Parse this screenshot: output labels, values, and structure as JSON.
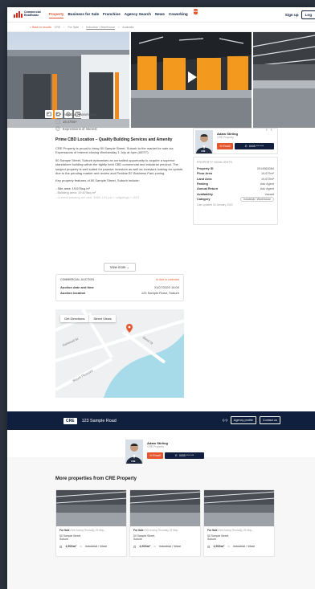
{
  "header": {
    "logo_line1": "Commercial",
    "logo_line2": "RealEstate",
    "nav": [
      "Property",
      "Business for Sale",
      "Franchise",
      "Agency Search",
      "News",
      "Coworking"
    ],
    "new_badge": "New",
    "signup": "Sign up",
    "login": "Log"
  },
  "breadcrumb": {
    "back": "< Back to results",
    "items": [
      "CRE",
      "For Sale",
      "Industrial / Warehouse",
      "Australia"
    ]
  },
  "listing": {
    "type": "Industrial / Warehouse",
    "area": "19,475m²",
    "method": "Expressions of Interest",
    "headline": "Prime CBD Location – Quality Building Services and Amenity",
    "para1": "CRE Property is proud to bring 50 Sample Street, Suburb to the market for sale via Expressions of Interest closing Wednesday 1 July at 4pm (AEST).",
    "para2": "50 Sample Street, Suburb epitomises an unrivalled opportunity to acquire a superior standalone building within the tightly held CBD commercial and industrial precinct. The subject property is well suited for passive investors as well as investors looking for upside, due to the pending market rent review and Flexible B7 Business Park zoning.",
    "para3": "Key property features of 50 Sample Street, Suburb include:",
    "bullet1": "- Site area: 19,675sq.m²",
    "bullet2": "- Building area: 19,675sq.m²",
    "bullet3": "- Current passing net rent: $466,101 pa + outgoings + GST",
    "view_more": "View more ⌄"
  },
  "auction": {
    "title": "COMMERCIAL AUCTION",
    "add_calendar": "Add to calendar",
    "date_label": "Auction date and time",
    "date_value": "31/07/2020 16:00",
    "loc_label": "Auction location",
    "loc_value": "123 Sample Road, Suburb"
  },
  "map": {
    "tab1": "Get Directions",
    "tab2": "Street Views",
    "streets": [
      "Harwood St",
      "Bond St",
      "Mount Pleasant"
    ]
  },
  "agent": {
    "name": "Adam Stirling",
    "company": "CRE Property",
    "email": "Email",
    "phone": "0435 *** ***",
    "cre_tag": "CRE",
    "prev": "‹",
    "next": "›"
  },
  "highlights": {
    "title": "PROPERTY HIGHLIGHTS",
    "rows": [
      {
        "label": "Property ID",
        "value": "2014563084"
      },
      {
        "label": "Floor Area",
        "value": "19,675m²"
      },
      {
        "label": "Land Area",
        "value": "19,675m²"
      },
      {
        "label": "Parking",
        "value": "Ask Agent"
      },
      {
        "label": "Annual Return",
        "value": "Ask Agent"
      },
      {
        "label": "Availability",
        "value": "Vacant"
      },
      {
        "label": "Category",
        "value": "Industrial / Warehouse"
      }
    ],
    "updated": "Last updated 30 January 2020"
  },
  "band": {
    "logo": "CRE",
    "address": "123 Sample Road",
    "agency_profile": "Agency profile",
    "contact_us": "Contact us"
  },
  "more": {
    "title": "More properties from CRE Property",
    "cards": [
      {
        "tag": "For Sale",
        "date": "Exit closing Thursday 29 May...",
        "addr1": "50 Sample Street,",
        "addr2": "Suburb",
        "area": "1,500m²",
        "type": "Industrial / Ware"
      },
      {
        "tag": "For Sale",
        "date": "Exit closing Thursday 29 May...",
        "addr1": "50 Sample Street,",
        "addr2": "Suburb",
        "area": "1,500m²",
        "type": "Industrial / Ware"
      },
      {
        "tag": "For Sale",
        "date": "Exit closing Thursday 29 May...",
        "addr1": "50 Sample Street,",
        "addr2": "Suburb",
        "area": "1,500m²",
        "type": "Industrial / Ware"
      }
    ]
  },
  "colors": {
    "accent": "#e4572e",
    "navy": "#0f1f3d",
    "brand_red": "#d62b1f"
  }
}
